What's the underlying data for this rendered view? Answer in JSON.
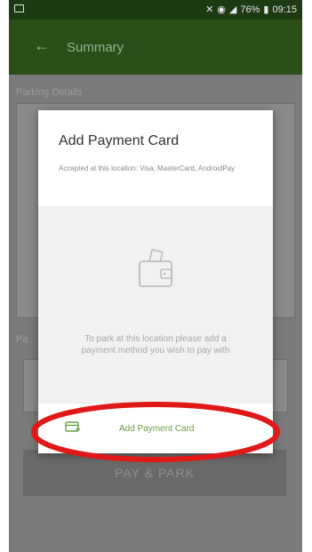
{
  "status_bar": {
    "battery_text": "76%",
    "time": "09:15",
    "icons": [
      "notification-icon",
      "mute-icon",
      "wifi-icon",
      "signal-icon",
      "battery-icon"
    ]
  },
  "app_bar": {
    "title": "Summary",
    "back_icon": "back-arrow-icon"
  },
  "background": {
    "section_1_label": "Parking Details",
    "section_2_label": "Pa",
    "pay_button_label": "PAY & PARK"
  },
  "dialog": {
    "title": "Add Payment Card",
    "accepted_text": "Accepted at this location: Visa, MasterCard, AndroidPay",
    "empty_message": "To park at this location please add a payment method you wish to pay with",
    "illustration_icon": "wallet-icon",
    "add_card_label": "Add Payment Card",
    "add_card_icon": "credit-card-icon"
  },
  "colors": {
    "status_bar": "#1d3a12",
    "app_bar": "#2c4e19",
    "accent_green": "#6a9e48",
    "annotation_red": "#e01818"
  }
}
